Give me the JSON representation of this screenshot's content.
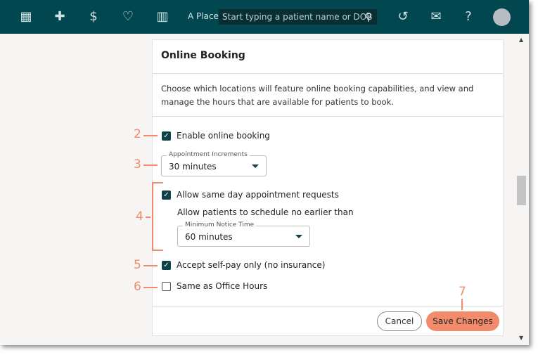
{
  "header": {
    "place": "A Place",
    "search_placeholder": "Start typing a patient name or DOB",
    "icons": [
      "grid-icon",
      "plus-icon",
      "dollar-icon",
      "heart-pin-icon",
      "bar-chart-icon",
      "search-icon",
      "history-icon",
      "mail-icon",
      "help-icon",
      "avatar"
    ]
  },
  "card": {
    "title": "Online Booking",
    "description": "Choose which locations will feature online booking capabilities, and view and manage the hours that are available for patients to book.",
    "enable_online_booking": {
      "label": "Enable online booking",
      "checked": true
    },
    "appointment_increments": {
      "caption": "Appointment Increments",
      "value": "30 minutes"
    },
    "same_day": {
      "label": "Allow same day appointment requests",
      "checked": true
    },
    "notice_text": "Allow patients to schedule no earlier than",
    "minimum_notice": {
      "caption": "Minimum Notice Time",
      "value": "60 minutes"
    },
    "self_pay": {
      "label": "Accept self-pay only (no insurance)",
      "checked": true
    },
    "office_hours": {
      "label": "Same as Office Hours",
      "checked": false
    },
    "cancel": "Cancel",
    "save": "Save Changes"
  },
  "callouts": [
    "2",
    "3",
    "4",
    "5",
    "6",
    "7"
  ],
  "colors": {
    "header": "#02474f",
    "accent": "#f28b6b",
    "checkbox": "#0e4148"
  }
}
